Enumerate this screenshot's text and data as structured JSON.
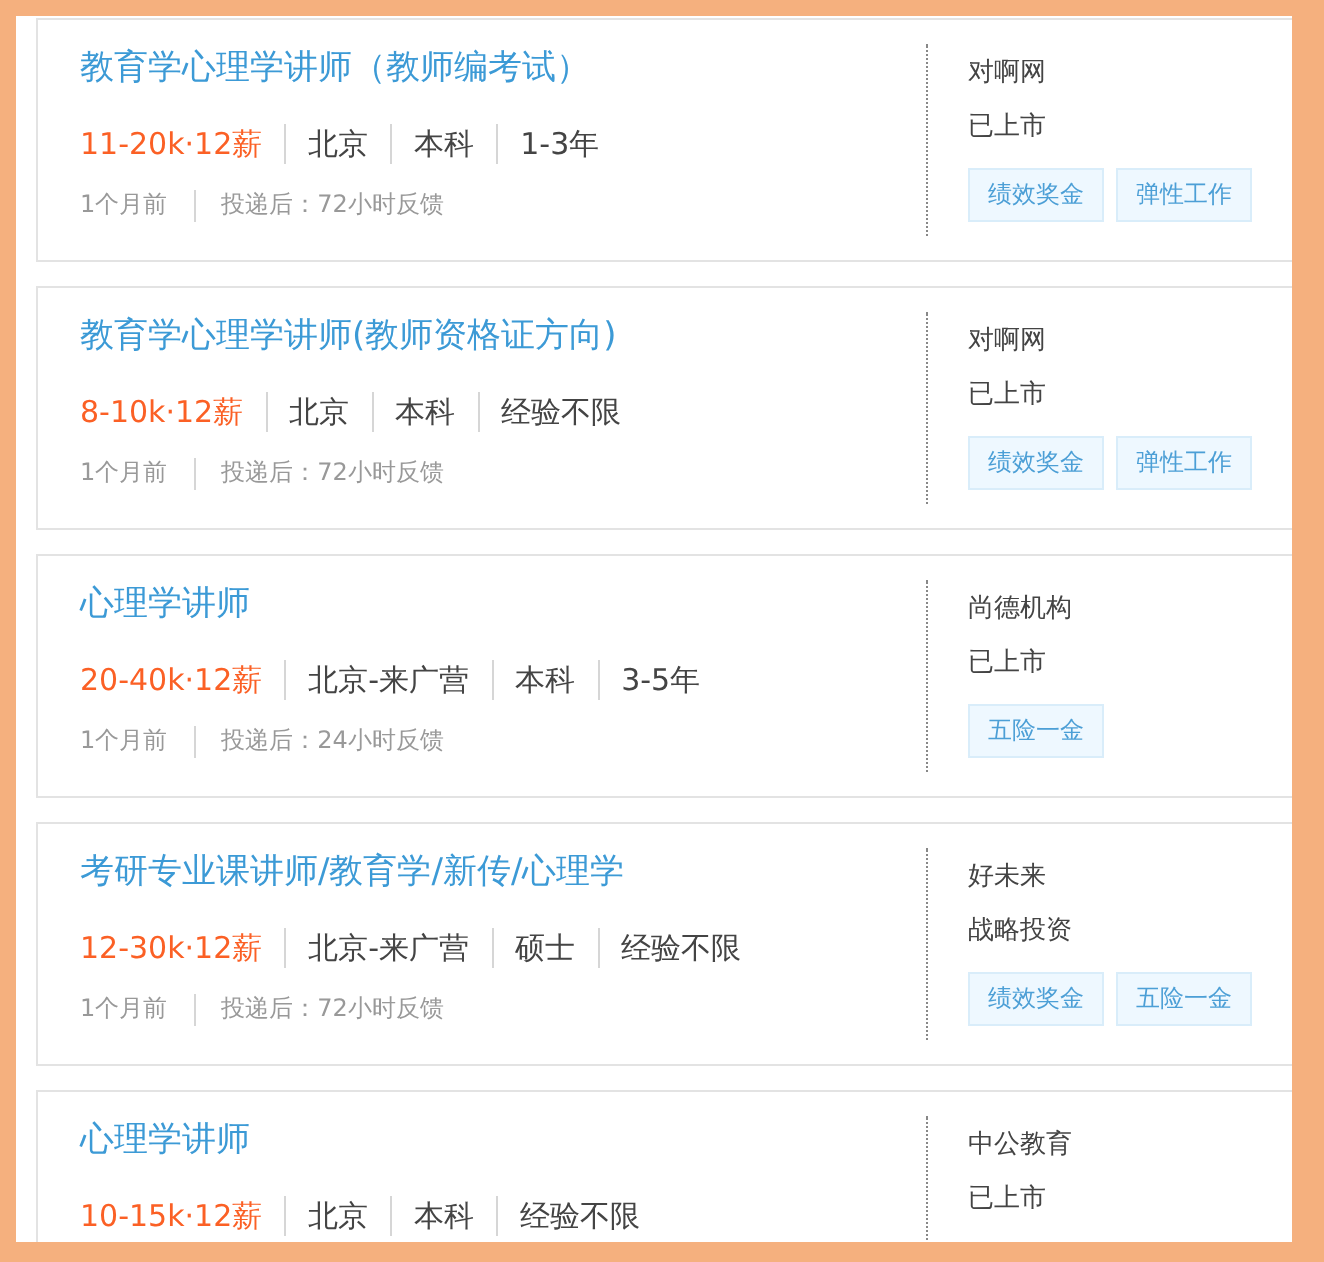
{
  "jobs": [
    {
      "title": "教育学心理学讲师（教师编考试）",
      "salary": "11-20k·12薪",
      "meta": [
        "北京",
        "本科",
        "1-3年"
      ],
      "posted": "1个月前",
      "feedback": "投递后：72小时反馈",
      "company": "对啊网",
      "stage": "已上市",
      "tags": [
        "绩效奖金",
        "弹性工作"
      ]
    },
    {
      "title": "教育学心理学讲师(教师资格证方向)",
      "salary": "8-10k·12薪",
      "meta": [
        "北京",
        "本科",
        "经验不限"
      ],
      "posted": "1个月前",
      "feedback": "投递后：72小时反馈",
      "company": "对啊网",
      "stage": "已上市",
      "tags": [
        "绩效奖金",
        "弹性工作"
      ]
    },
    {
      "title": "心理学讲师",
      "salary": "20-40k·12薪",
      "meta": [
        "北京-来广营",
        "本科",
        "3-5年"
      ],
      "posted": "1个月前",
      "feedback": "投递后：24小时反馈",
      "company": "尚德机构",
      "stage": "已上市",
      "tags": [
        "五险一金"
      ]
    },
    {
      "title": "考研专业课讲师/教育学/新传/心理学",
      "salary": "12-30k·12薪",
      "meta": [
        "北京-来广营",
        "硕士",
        "经验不限"
      ],
      "posted": "1个月前",
      "feedback": "投递后：72小时反馈",
      "company": "好未来",
      "stage": "战略投资",
      "tags": [
        "绩效奖金",
        "五险一金"
      ]
    },
    {
      "title": "心理学讲师",
      "salary": "10-15k·12薪",
      "meta": [
        "北京",
        "本科",
        "经验不限"
      ],
      "company": "中公教育",
      "stage": "已上市"
    }
  ]
}
